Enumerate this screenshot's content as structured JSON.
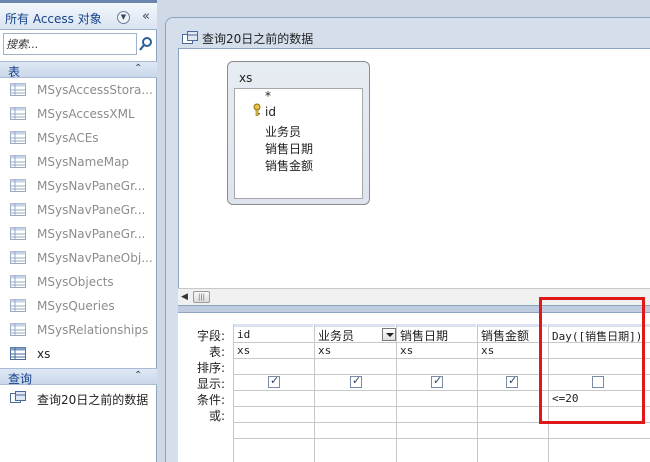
{
  "nav": {
    "title": "所有 Access 对象",
    "search_placeholder": "搜索...",
    "groups": {
      "tables": {
        "label": "表",
        "items": [
          {
            "label": "MSysAccessStora..."
          },
          {
            "label": "MSysAccessXML"
          },
          {
            "label": "MSysACEs"
          },
          {
            "label": "MSysNameMap"
          },
          {
            "label": "MSysNavPaneGr..."
          },
          {
            "label": "MSysNavPaneGr..."
          },
          {
            "label": "MSysNavPaneGr..."
          },
          {
            "label": "MSysNavPaneObj..."
          },
          {
            "label": "MSysObjects"
          },
          {
            "label": "MSysQueries"
          },
          {
            "label": "MSysRelationships"
          },
          {
            "label": "xs"
          }
        ]
      },
      "queries": {
        "label": "查询",
        "items": [
          {
            "label": "查询20日之前的数据"
          }
        ]
      }
    }
  },
  "document": {
    "tab_label": "查询20日之前的数据",
    "field_list": {
      "title": "xs",
      "fields": [
        "*",
        "id",
        "业务员",
        "销售日期",
        "销售金额"
      ]
    },
    "grid": {
      "row_labels": [
        "字段:",
        "表:",
        "排序:",
        "显示:",
        "条件:",
        "或:"
      ],
      "columns": [
        {
          "field": "id",
          "table": "xs",
          "show": true,
          "criteria": ""
        },
        {
          "field": "业务员",
          "table": "xs",
          "show": true,
          "criteria": ""
        },
        {
          "field": "销售日期",
          "table": "xs",
          "show": true,
          "criteria": ""
        },
        {
          "field": "销售金额",
          "table": "xs",
          "show": true,
          "criteria": ""
        },
        {
          "field": "Day([销售日期])",
          "table": "",
          "show": false,
          "criteria": "<=20"
        }
      ]
    }
  },
  "colors": {
    "highlight": "#e01818",
    "nav_header_text": "#15428b"
  }
}
